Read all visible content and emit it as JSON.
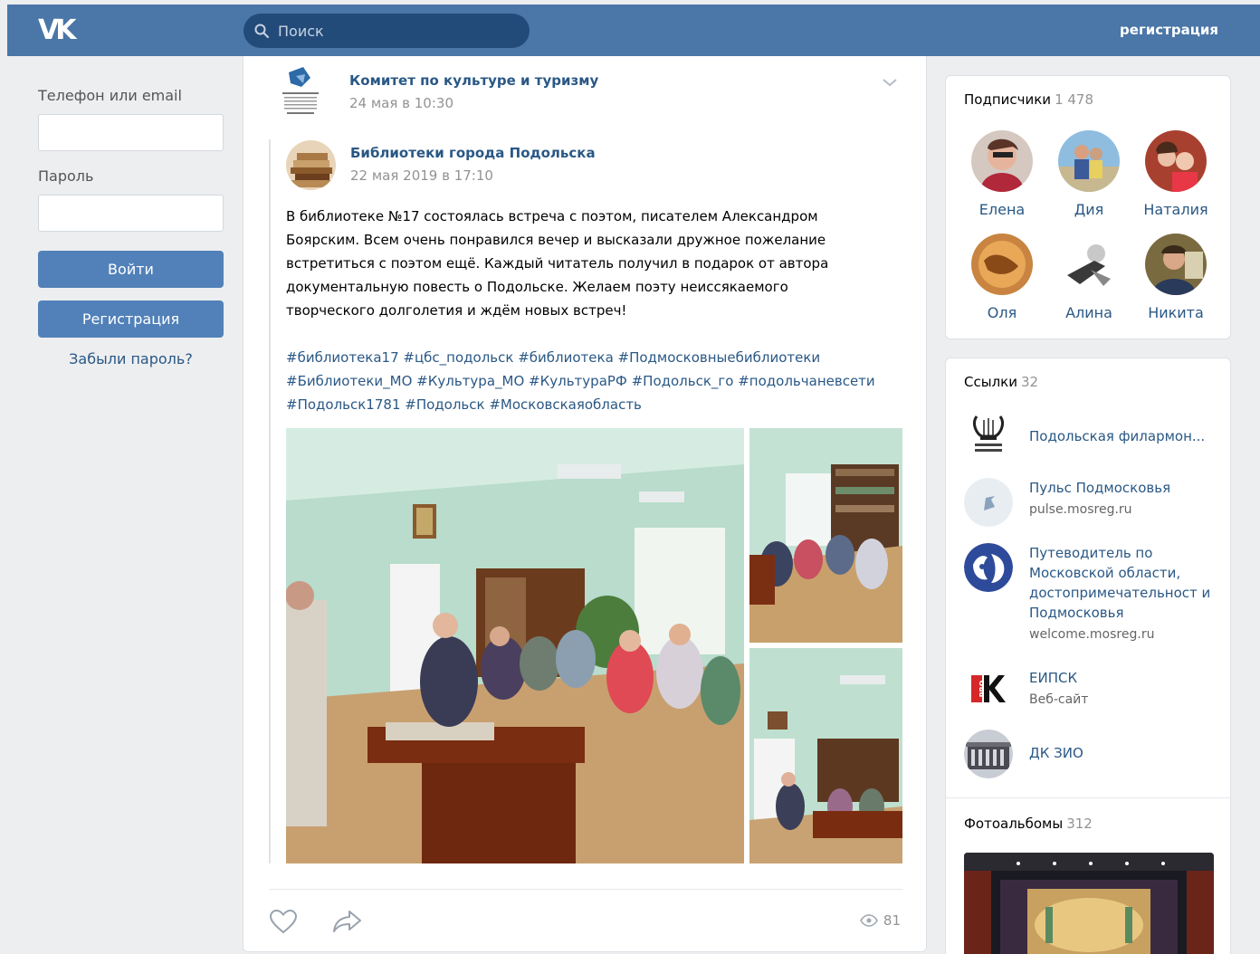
{
  "header": {
    "logo": "VK",
    "search_placeholder": "Поиск",
    "register_label": "регистрация"
  },
  "login": {
    "phone_label": "Телефон или email",
    "password_label": "Пароль",
    "login_button": "Войти",
    "register_button": "Регистрация",
    "forgot_link": "Забыли пароль?"
  },
  "post": {
    "author": "Комитет по культуре и туризму",
    "date": "24 мая в 10:30",
    "repost": {
      "author": "Библиотеки города Подольска",
      "date": "22 мая 2019 в 17:10"
    },
    "text_lines": [
      "В библиотеке №17 состоялась встреча с поэтом, писателем Александром",
      "Боярским. Всем очень понравился вечер и высказали дружное пожелание",
      "встретиться с поэтом ещё. Каждый читатель получил в подарок от автора",
      "документальную повесть о Подольске. Желаем поэту неиссякаемого",
      "творческого долголетия и ждём новых встреч!"
    ],
    "tag_lines": [
      "#библиотека17 #цбс_подольск #библиотека #Подмосковныебиблиотеки",
      "#Библиотеки_МО #Культура_МО #КультураРФ #Подольск_го #подольчаневсети",
      "#Подольск1781 #Подольск #Московскаяобласть"
    ],
    "views": "81"
  },
  "subscribers": {
    "title": "Подписчики",
    "count": "1 478",
    "items": [
      {
        "name": "Елена"
      },
      {
        "name": "Дия"
      },
      {
        "name": "Наталия"
      },
      {
        "name": "Оля"
      },
      {
        "name": "Алина"
      },
      {
        "name": "Никита"
      }
    ]
  },
  "links": {
    "title": "Ссылки",
    "count": "32",
    "items": [
      {
        "name": "Подольская филармон...",
        "url": ""
      },
      {
        "name": "Пульс Подмосковья",
        "url": "pulse.mosreg.ru"
      },
      {
        "name": "Путеводитель по Московской области, достопримечательност и Подмосковья",
        "url": "welcome.mosreg.ru"
      },
      {
        "name": "ЕИПСК",
        "url": "Веб-сайт"
      },
      {
        "name": "ДК ЗИО",
        "url": ""
      }
    ]
  },
  "albums": {
    "title": "Фотоальбомы",
    "count": "312"
  },
  "colors": {
    "header": "#4a76a8",
    "link": "#2a5885",
    "button": "#5181b8",
    "background": "#edeef0"
  }
}
